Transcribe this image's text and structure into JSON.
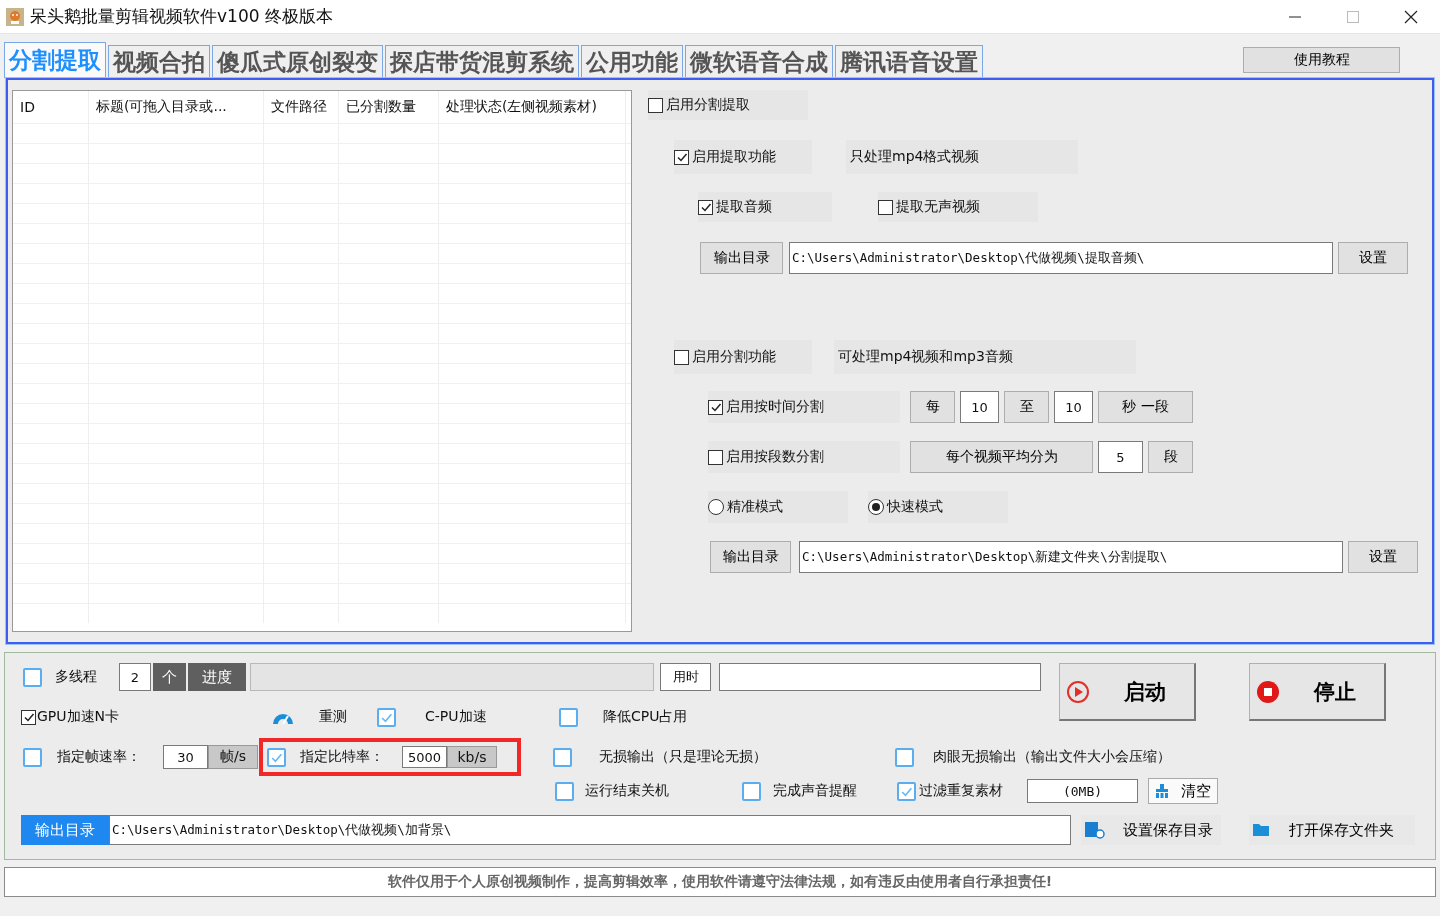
{
  "window": {
    "title": "呆头鹅批量剪辑视频软件v100 终极版本"
  },
  "tabs": [
    {
      "label": "分割提取",
      "selected": true
    },
    {
      "label": "视频合拍",
      "selected": false
    },
    {
      "label": "傻瓜式原创裂变",
      "selected": false
    },
    {
      "label": "探店带货混剪系统",
      "selected": false
    },
    {
      "label": "公用功能",
      "selected": false
    },
    {
      "label": "微软语音合成",
      "selected": false
    },
    {
      "label": "腾讯语音设置",
      "selected": false
    }
  ],
  "tutorial_button": "使用教程",
  "file_table": {
    "columns": [
      "ID",
      "标题(可拖入目录或...",
      "文件路径",
      "已分割数量",
      "处理状态(左侧视频素材)"
    ]
  },
  "split_extract": {
    "enable": {
      "label": "启用分割提取",
      "checked": false
    },
    "extract": {
      "enable": {
        "label": "启用提取功能",
        "checked": true
      },
      "note": "只处理mp4格式视频",
      "audio": {
        "label": "提取音频",
        "checked": true
      },
      "silent_video": {
        "label": "提取无声视频",
        "checked": false
      },
      "output": {
        "button": "输出目录",
        "path": "C:\\Users\\Administrator\\Desktop\\代做视频\\提取音频\\",
        "set_button": "设置"
      }
    },
    "split": {
      "enable": {
        "label": "启用分割功能",
        "checked": false
      },
      "note": "可处理mp4视频和mp3音频",
      "by_time": {
        "label": "启用按时间分割",
        "checked": true,
        "every": "每",
        "from": "10",
        "to_label": "至",
        "to": "10",
        "unit": "秒 一段"
      },
      "by_count": {
        "label": "启用按段数分割",
        "checked": false,
        "prefix": "每个视频平均分为",
        "count": "5",
        "unit": "段"
      },
      "modes": [
        {
          "label": "精准模式",
          "selected": false
        },
        {
          "label": "快速模式",
          "selected": true
        }
      ],
      "output": {
        "button": "输出目录",
        "path": "C:\\Users\\Administrator\\Desktop\\新建文件夹\\分割提取\\",
        "set_button": "设置"
      }
    }
  },
  "bottom": {
    "multithread": {
      "label": "多线程",
      "checked": false,
      "count": "2",
      "unit": "个"
    },
    "progress": {
      "label": "进度",
      "level": 0
    },
    "elapsed_label": "用时",
    "start_button": "启动",
    "stop_button": "停止",
    "gpu_nvidia": {
      "label": "GPU加速N卡",
      "checked": true
    },
    "retest_button": "重测",
    "cpu_accel": {
      "label": "C-PU加速",
      "checked": true
    },
    "reduce_cpu": {
      "label": "降低CPU占用",
      "checked": false
    },
    "frame_rate": {
      "label": "指定帧速率：",
      "checked": false,
      "value": "30",
      "unit": "帧/s"
    },
    "bitrate": {
      "label": "指定比特率：",
      "checked": true,
      "value": "5000",
      "unit": "kb/s"
    },
    "lossless": {
      "label": "无损输出（只是理论无损）",
      "checked": false
    },
    "visual_lossless": {
      "label": "肉眼无损输出（输出文件大小会压缩）",
      "checked": false
    },
    "shutdown": {
      "label": "运行结束关机",
      "checked": false
    },
    "sound_alert": {
      "label": "完成声音提醒",
      "checked": false
    },
    "filter_duplicates": {
      "label": "过滤重复素材",
      "checked": true,
      "size": "(0MB)",
      "clear_button": "清空"
    },
    "output": {
      "label": "输出目录",
      "path": "C:\\Users\\Administrator\\Desktop\\代做视频\\加背景\\"
    },
    "set_save_dir_button": "设置保存目录",
    "open_save_folder_button": "打开保存文件夹"
  },
  "notice": "软件仅用于个人原创视频制作，提高剪辑效率，使用软件请遵守法律法规，如有违反由使用者自行承担责任!"
}
